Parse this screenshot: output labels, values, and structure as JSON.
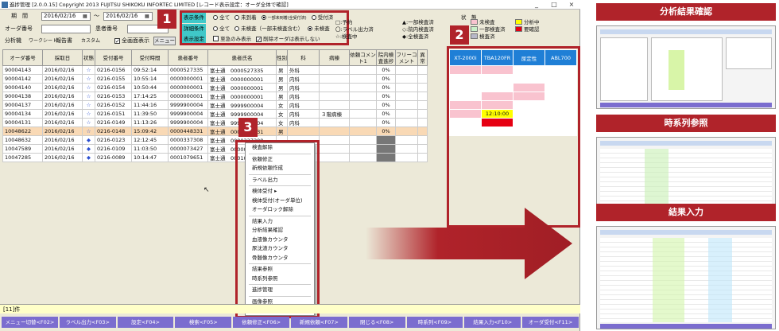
{
  "window": {
    "title": "進捗管理 [2.0.0.15]  Copyright 2013 FUJITSU SHIKOKU INFORTEC LIMITED  [レコード表示設定：オーダ全体で確認]",
    "controls": [
      "_",
      "□",
      "×"
    ]
  },
  "filters": {
    "period_label": "期　間",
    "date_from": "2016/02/16",
    "tilde": "～",
    "date_to": "2016/02/16",
    "order_no_label": "オーダ番号",
    "patient_no_label": "患者番号",
    "worksheet_label": "分析機",
    "worksheet_tabs": [
      "ワークシート",
      "報告書",
      "カスタム"
    ],
    "full_screen": "全画面表示",
    "menu_button": "メニュー"
  },
  "conditions": {
    "display": {
      "tag": "表示条件",
      "options": [
        "全て",
        "未到着",
        "一部未到着(全受付済)",
        "受付済"
      ]
    },
    "detail": {
      "tag": "詳細条件",
      "options": [
        "全て",
        "未検査（一部未検査含む）",
        "未検査"
      ]
    },
    "setting": {
      "tag": "表示設定",
      "options": [
        "至急のみ表示",
        "削除オーダは表示しない"
      ]
    }
  },
  "legend": {
    "title": "状　態",
    "left": [
      "□:予約",
      "〇:ラベル出力済",
      "☆:検査中"
    ],
    "mid": [
      "▲:一部検査済",
      "◇:院内検査済",
      "◆:全検査済"
    ],
    "colors": [
      {
        "label": "未検査",
        "color": "#f9c3cf"
      },
      {
        "label": "分析中",
        "color": "#ffff00"
      },
      {
        "label": "一部検査済",
        "color": "#c8f0c8"
      },
      {
        "label": "要確認",
        "color": "#e60012"
      },
      {
        "label": "検査済",
        "color": "#b8b8c8"
      }
    ]
  },
  "badges": [
    "1",
    "2",
    "3"
  ],
  "grid": {
    "headers": [
      "オーダ番号",
      "採取日",
      "状態",
      "受付番号",
      "受付時間",
      "患者番号",
      "患者氏名",
      "性別",
      "科",
      "病棟",
      "依頼コメント1",
      "院内検査進捗",
      "フリーコメント",
      "異常"
    ],
    "rows": [
      [
        "90004143",
        "2016/02/16",
        "☆",
        "0216-0156",
        "09:52:14",
        "0000527335",
        "富士通　0000527335",
        "男",
        "外科",
        "",
        "",
        "0%"
      ],
      [
        "90004142",
        "2016/02/16",
        "☆",
        "0216-0155",
        "10:55:14",
        "0000000001",
        "富士通　0000000001",
        "男",
        "内科",
        "",
        "",
        "0%"
      ],
      [
        "90004140",
        "2016/02/16",
        "☆",
        "0216-0154",
        "10:50:44",
        "0000000001",
        "富士通　0000000001",
        "男",
        "内科",
        "",
        "",
        "0%"
      ],
      [
        "90004138",
        "2016/02/16",
        "☆",
        "0216-0153",
        "17:14:25",
        "0000000001",
        "富士通　0000000001",
        "男",
        "内科",
        "",
        "",
        "0%"
      ],
      [
        "90004137",
        "2016/02/16",
        "☆",
        "0216-0152",
        "11:44:16",
        "9999900004",
        "富士通　9999900004",
        "女",
        "内科",
        "",
        "",
        "0%"
      ],
      [
        "90004134",
        "2016/02/16",
        "☆",
        "0216-0151",
        "11:39:50",
        "9999900004",
        "富士通　9999900004",
        "女",
        "内科",
        "３階病棟",
        "",
        "0%"
      ],
      [
        "90004131",
        "2016/02/16",
        "☆",
        "0216-0149",
        "11:13:26",
        "9999900004",
        "富士通　9999900004",
        "女",
        "内科",
        "",
        "",
        "0%"
      ],
      [
        "10048622",
        "2016/02/16",
        "☆",
        "0216-0148",
        "15:09:42",
        "0000448331",
        "富士通　0000448331",
        "男",
        "",
        "",
        "",
        "0%"
      ],
      [
        "10048632",
        "2016/02/16",
        "◆",
        "0216-0123",
        "12:12:45",
        "0000337308",
        "富士通　0000337308",
        "",
        "",
        "",
        "",
        ""
      ],
      [
        "10047589",
        "2016/02/16",
        "◆",
        "0216-0109",
        "11:03:50",
        "0000073427",
        "富士通　0000073427",
        "",
        "",
        "",
        "",
        ""
      ],
      [
        "10047285",
        "2016/02/16",
        "◆",
        "0216-0089",
        "10:14:47",
        "0001079651",
        "富士通　0001079651",
        "",
        "",
        "",
        "",
        ""
      ]
    ]
  },
  "analyzers": {
    "headers": [
      "XT-2000i",
      "TBA120FR",
      "尿定性",
      "ABL700"
    ],
    "yellow_time": "12:10:00"
  },
  "context_menu": [
    [
      "検査解除"
    ],
    [
      "依頼修正",
      "新規依頼作成"
    ],
    [
      "ラベル出力"
    ],
    [
      "検体受付 ▸",
      "検体受付(オーダ単位)",
      "オーダロック解除"
    ],
    [
      "結果入力",
      "分析結果確認",
      "血液像カウンタ",
      "尿沈渣カウンタ",
      "骨髄像カウンタ"
    ],
    [
      "結果参照",
      "時系列参照"
    ],
    [
      "進捗管理"
    ],
    [
      "画像参照"
    ]
  ],
  "status": {
    "count": "[11]件"
  },
  "function_keys": [
    "メニュー切替<F02>",
    "ラベル出力<F03>",
    "設定<F04>",
    "検索<F05>",
    "依頼修正<F06>",
    "新規依頼<F07>",
    "閉じる<F08>",
    "時系列<F09>",
    "結果入力<F10>",
    "オーダ受付<F11>"
  ],
  "right_panels": [
    {
      "title": "分析結果確認"
    },
    {
      "title": "時系列参照"
    },
    {
      "title": "結果入力"
    }
  ],
  "accent": "#b0232a"
}
